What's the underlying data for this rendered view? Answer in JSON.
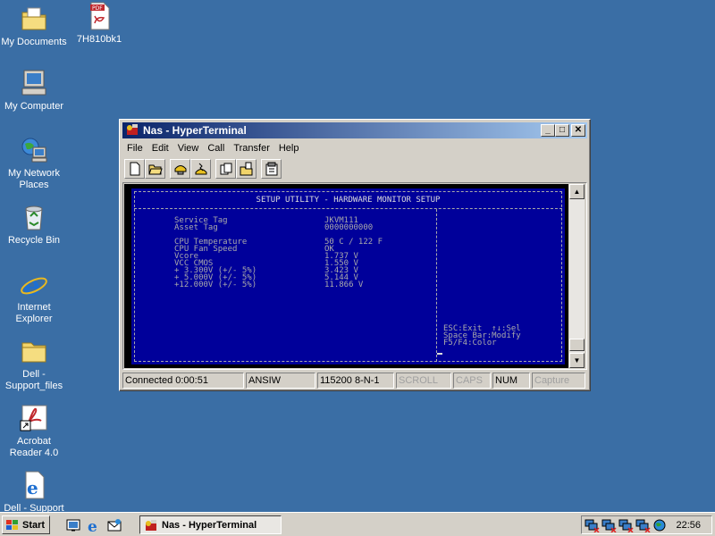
{
  "desktop": {
    "icons": [
      {
        "label": "My Documents",
        "icon": "folder-documents-icon"
      },
      {
        "label": "7H810bk1",
        "icon": "pdf-file-icon"
      },
      {
        "label": "My Computer",
        "icon": "computer-icon"
      },
      {
        "label": "My Network Places",
        "icon": "network-places-icon"
      },
      {
        "label": "Recycle Bin",
        "icon": "recycle-bin-icon"
      },
      {
        "label": "Internet Explorer",
        "icon": "internet-explorer-icon"
      },
      {
        "label": "Dell - Support_files",
        "icon": "folder-icon"
      },
      {
        "label": "Acrobat Reader 4.0",
        "icon": "acrobat-shortcut-icon"
      },
      {
        "label": "Dell - Support",
        "icon": "ie-document-icon"
      }
    ]
  },
  "window": {
    "title": "Nas - HyperTerminal",
    "buttons": {
      "minimize": "_",
      "maximize": "□",
      "close": "✕"
    },
    "menu": [
      "File",
      "Edit",
      "View",
      "Call",
      "Transfer",
      "Help"
    ],
    "toolbar": [
      "new-icon",
      "open-icon",
      "connect-icon",
      "disconnect-icon",
      "send-icon",
      "receive-icon",
      "properties-icon"
    ],
    "status": {
      "connected": "Connected 0:00:51",
      "emulation": "ANSIW",
      "settings": "115200 8-N-1",
      "scroll": "SCROLL",
      "caps": "CAPS",
      "num": "NUM",
      "capture": "Capture"
    }
  },
  "terminal": {
    "header": "SETUP UTILITY - HARDWARE MONITOR SETUP",
    "rows": [
      {
        "label": "Service Tag",
        "value": "JKVM111"
      },
      {
        "label": "Asset Tag",
        "value": "0000000000"
      },
      {
        "label": "CPU Temperature",
        "value": "50 C / 122 F"
      },
      {
        "label": "CPU Fan Speed",
        "value": "OK"
      },
      {
        "label": "Vcore",
        "value": "1.737 V"
      },
      {
        "label": "VCC CMOS",
        "value": "1.550 V"
      },
      {
        "label": "+ 3.300V (+/- 5%)",
        "value": "3.423 V"
      },
      {
        "label": "+ 5.000V (+/- 5%)",
        "value": "5.144 V"
      },
      {
        "label": "+12.000V (+/- 5%)",
        "value": "11.866 V"
      }
    ],
    "help": [
      "ESC:Exit  ↑↓:Sel",
      "Space Bar:Modify",
      "F5/F4:Color"
    ]
  },
  "taskbar": {
    "start": "Start",
    "task": "Nas - HyperTerminal",
    "clock": "22:56"
  }
}
